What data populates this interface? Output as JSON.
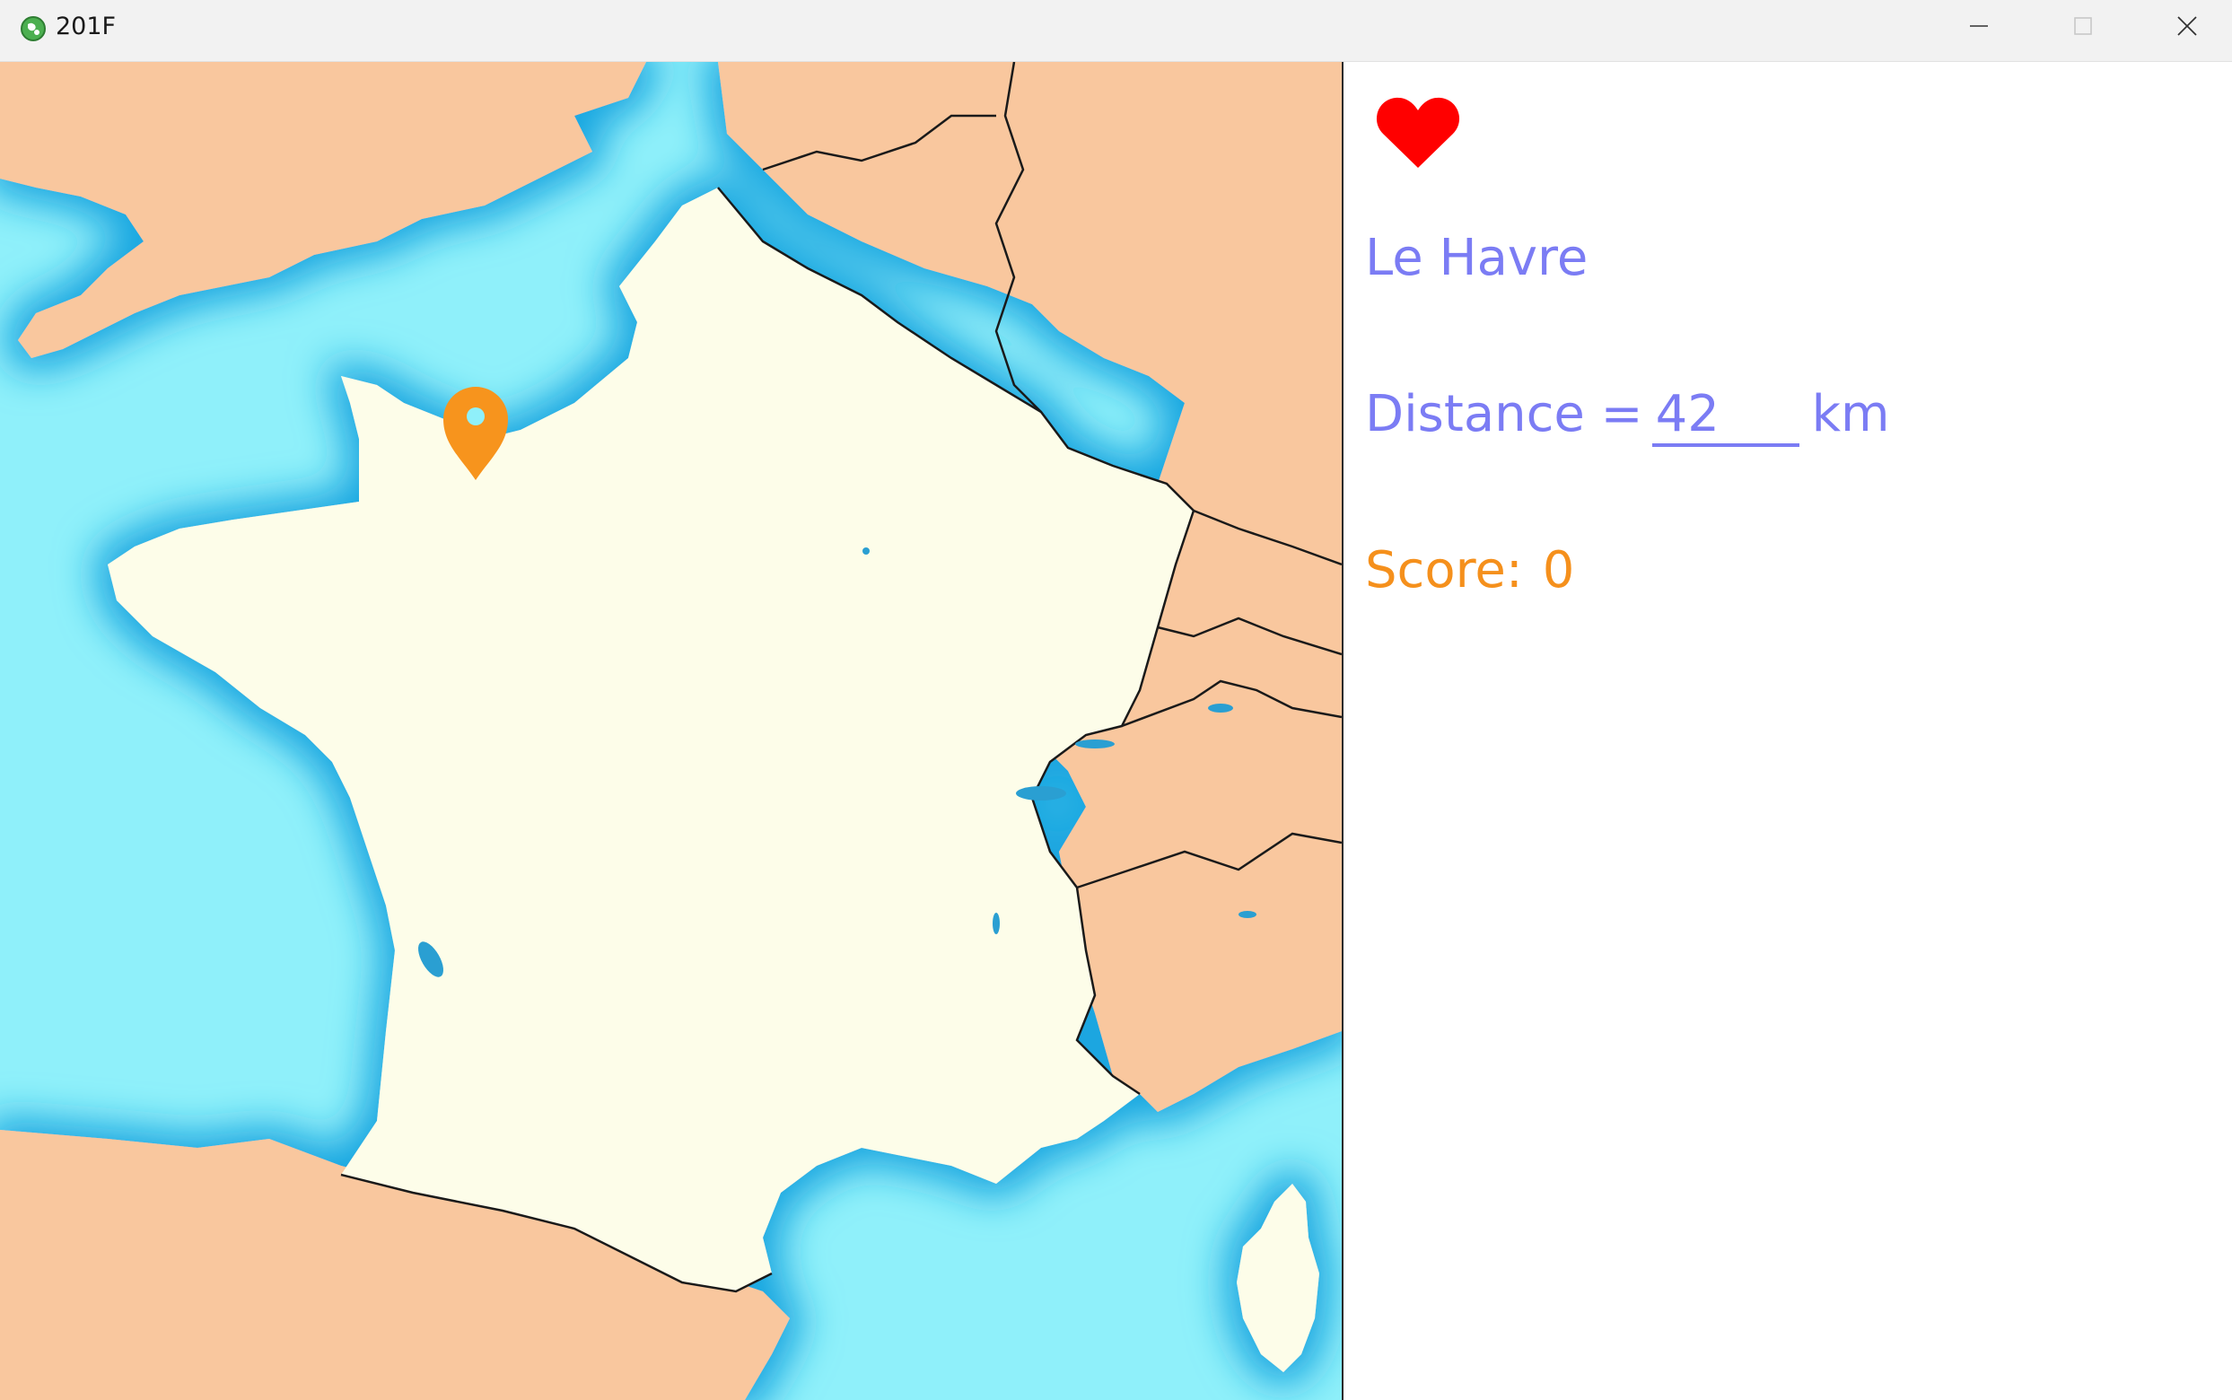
{
  "window": {
    "title": "201F",
    "app_icon": "globe-icon",
    "controls": [
      "minimize-icon",
      "maximize-icon",
      "close-icon"
    ]
  },
  "map": {
    "region": "France",
    "marker": {
      "icon": "map-pin-icon",
      "color": "#f7941d"
    },
    "colors": {
      "sea": "#8ff0fa",
      "deep_sea": "#2fbde8",
      "france": "#fdfde9",
      "neighbors": "#f9c79e",
      "borders": "#1a1a1a"
    }
  },
  "game": {
    "lives_icon": "heart-icon",
    "lives_color": "#ff0000",
    "city": "Le Havre",
    "distance_label": "Distance =",
    "distance_value": "42",
    "distance_unit": "km",
    "score_label": "Score:",
    "score_value": "0",
    "text_color": "#7b7cf4",
    "score_color": "#f5901c"
  }
}
